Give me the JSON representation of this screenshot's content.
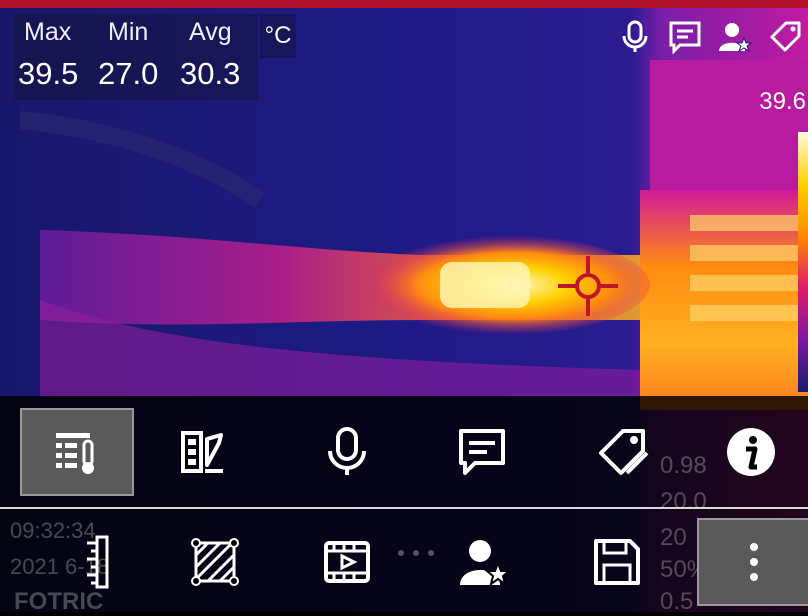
{
  "stats": {
    "headers": [
      "Max",
      "Min",
      "Avg"
    ],
    "values": [
      "39.5",
      "27.0",
      "30.3"
    ],
    "unit": "°C"
  },
  "scale": {
    "max": "39.6"
  },
  "toolbar_top": [
    {
      "name": "microphone-icon"
    },
    {
      "name": "text-note-icon"
    },
    {
      "name": "user-star-icon"
    },
    {
      "name": "tag-icon"
    }
  ],
  "menu": {
    "row1": [
      {
        "name": "thermometer-settings-button",
        "selected": true
      },
      {
        "name": "palette-edit-button",
        "selected": false
      },
      {
        "name": "voice-note-button",
        "selected": false
      },
      {
        "name": "text-note-button",
        "selected": false
      },
      {
        "name": "tag-button",
        "selected": false
      },
      {
        "name": "info-button",
        "selected": false
      }
    ],
    "row2": [
      {
        "name": "measure-ruler-button",
        "selected": false
      },
      {
        "name": "area-box-button",
        "selected": false
      },
      {
        "name": "video-button",
        "selected": false
      },
      {
        "name": "user-star-button",
        "selected": false
      },
      {
        "name": "save-button",
        "selected": false
      },
      {
        "name": "more-button",
        "selected": true
      }
    ]
  },
  "background_ghost": {
    "time": "09:32:34",
    "date": "2021 6-18",
    "brand": "FOTRIC",
    "right_values": [
      "0.98",
      "20.0",
      "20",
      "50%",
      "0.5"
    ]
  }
}
